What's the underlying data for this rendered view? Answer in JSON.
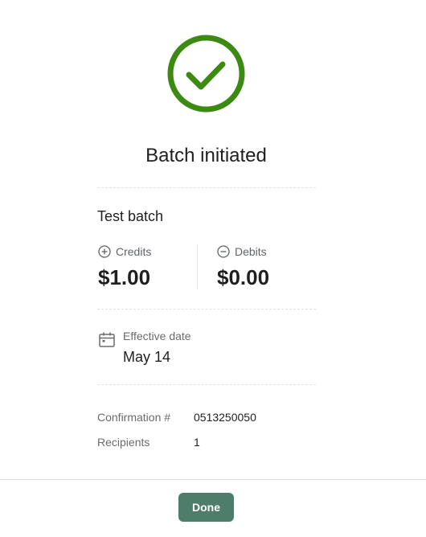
{
  "header": {
    "icon": "checkmark-circle-icon",
    "title": "Batch initiated",
    "accent_color": "#3b8a12"
  },
  "batch": {
    "name": "Test batch",
    "credits": {
      "label": "Credits",
      "icon": "plus-circle-icon",
      "value": "$1.00"
    },
    "debits": {
      "label": "Debits",
      "icon": "minus-circle-icon",
      "value": "$0.00"
    }
  },
  "effective_date": {
    "icon": "calendar-icon",
    "label": "Effective date",
    "value": "May 14"
  },
  "details": [
    {
      "label": "Confirmation #",
      "value": "0513250050"
    },
    {
      "label": "Recipients",
      "value": "1"
    }
  ],
  "footer": {
    "done_label": "Done",
    "button_color": "#4f7d6c"
  }
}
